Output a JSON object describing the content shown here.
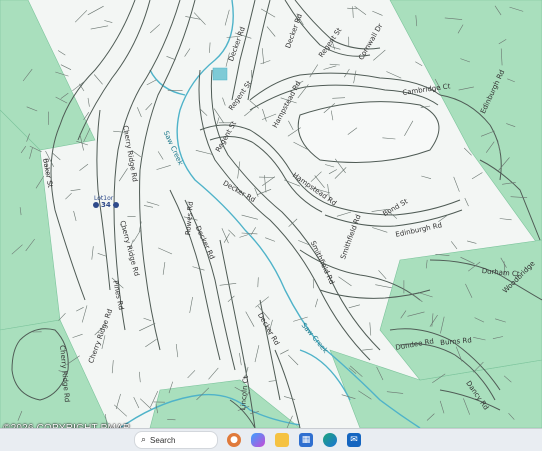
{
  "map": {
    "streets": [
      "Decker Rd",
      "Regent St",
      "Cornwall Dr",
      "Cambridge Ct",
      "Edinburgh Rd",
      "Hampstead Rd",
      "Regent St",
      "Decker Rd",
      "Bond St",
      "Edinburgh Rd",
      "Hampstead Rd",
      "Decker Rd",
      "Smithfield Rd",
      "Decker Rd",
      "Regent St",
      "Cherry Ridge Rd",
      "Cherry Ridge Rd",
      "Pines Rd",
      "Rowes Rd",
      "Lincoln Ct",
      "Durham Ct",
      "Woodbridge",
      "Dundee Rd",
      "Decker Rd",
      "Burns Rd",
      "Dancy Rd",
      "Cherry Ridge Rd",
      "Baker St",
      "Cherry Ridge Rd",
      "Smithfield Rd"
    ],
    "creeks": [
      "Saw Creek",
      "Saw Creek"
    ],
    "lot_tag": "Lot1or",
    "lot_number": "34"
  },
  "copyright": "©2026 COPYRIGHT PMAR",
  "taskbar": {
    "search_label": "Search",
    "icons": [
      "start-icon",
      "search-icon",
      "news-widget-icon",
      "copilot-icon",
      "file-explorer-icon",
      "store-icon",
      "edge-icon",
      "outlook-icon"
    ]
  },
  "colors": {
    "forest": "#a9dfbd",
    "background": "#f3f6f4",
    "road": "#4f5b55",
    "creek": "#4fb3c9",
    "taskbar": "#e9edf2"
  }
}
